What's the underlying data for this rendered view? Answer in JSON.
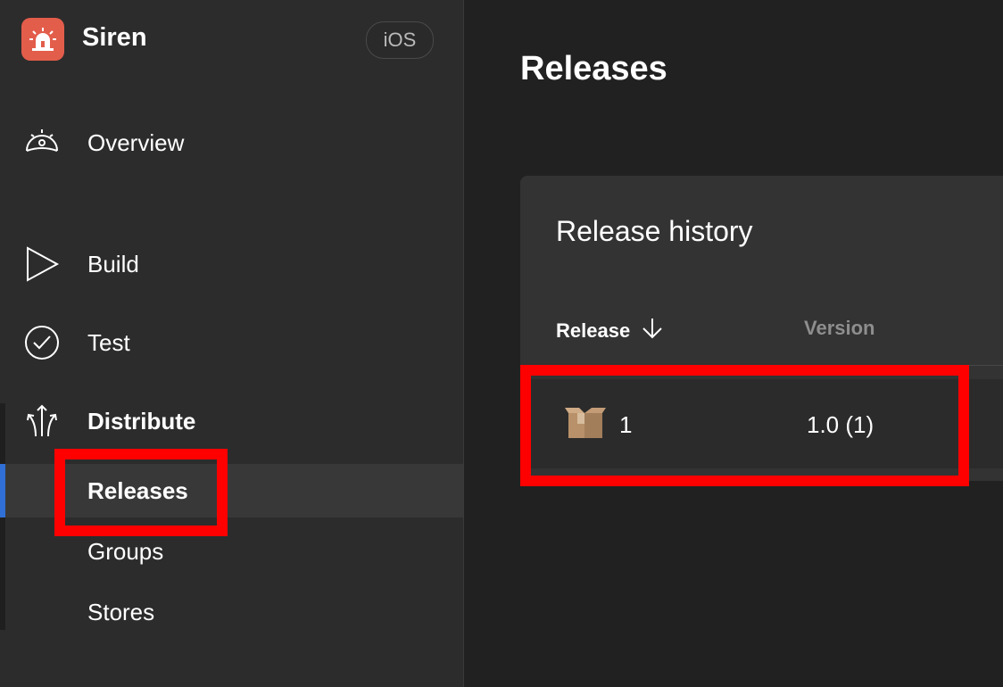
{
  "app": {
    "name": "Siren",
    "platform": "iOS",
    "logo_icon": "siren-icon",
    "logo_color": "#e35d4b"
  },
  "sidebar": {
    "items": [
      {
        "label": "Overview",
        "icon": "speedometer-icon"
      },
      {
        "label": "Build",
        "icon": "play-icon"
      },
      {
        "label": "Test",
        "icon": "check-circle-icon"
      },
      {
        "label": "Distribute",
        "icon": "distribute-arrows-icon"
      }
    ],
    "distribute_subitems": [
      {
        "label": "Releases",
        "active": true
      },
      {
        "label": "Groups",
        "active": false
      },
      {
        "label": "Stores",
        "active": false
      }
    ],
    "active_accent": "#2f6fd6"
  },
  "main": {
    "title": "Releases",
    "card": {
      "title": "Release history",
      "columns": [
        {
          "label": "Release",
          "sort": "descending",
          "sort_icon": "arrow-down-icon"
        },
        {
          "label": "Version"
        }
      ],
      "rows": [
        {
          "release": "1",
          "version": "1.0 (1)",
          "icon": "package-box-icon"
        }
      ]
    }
  },
  "annotations": {
    "highlight_color": "#ff0000"
  }
}
